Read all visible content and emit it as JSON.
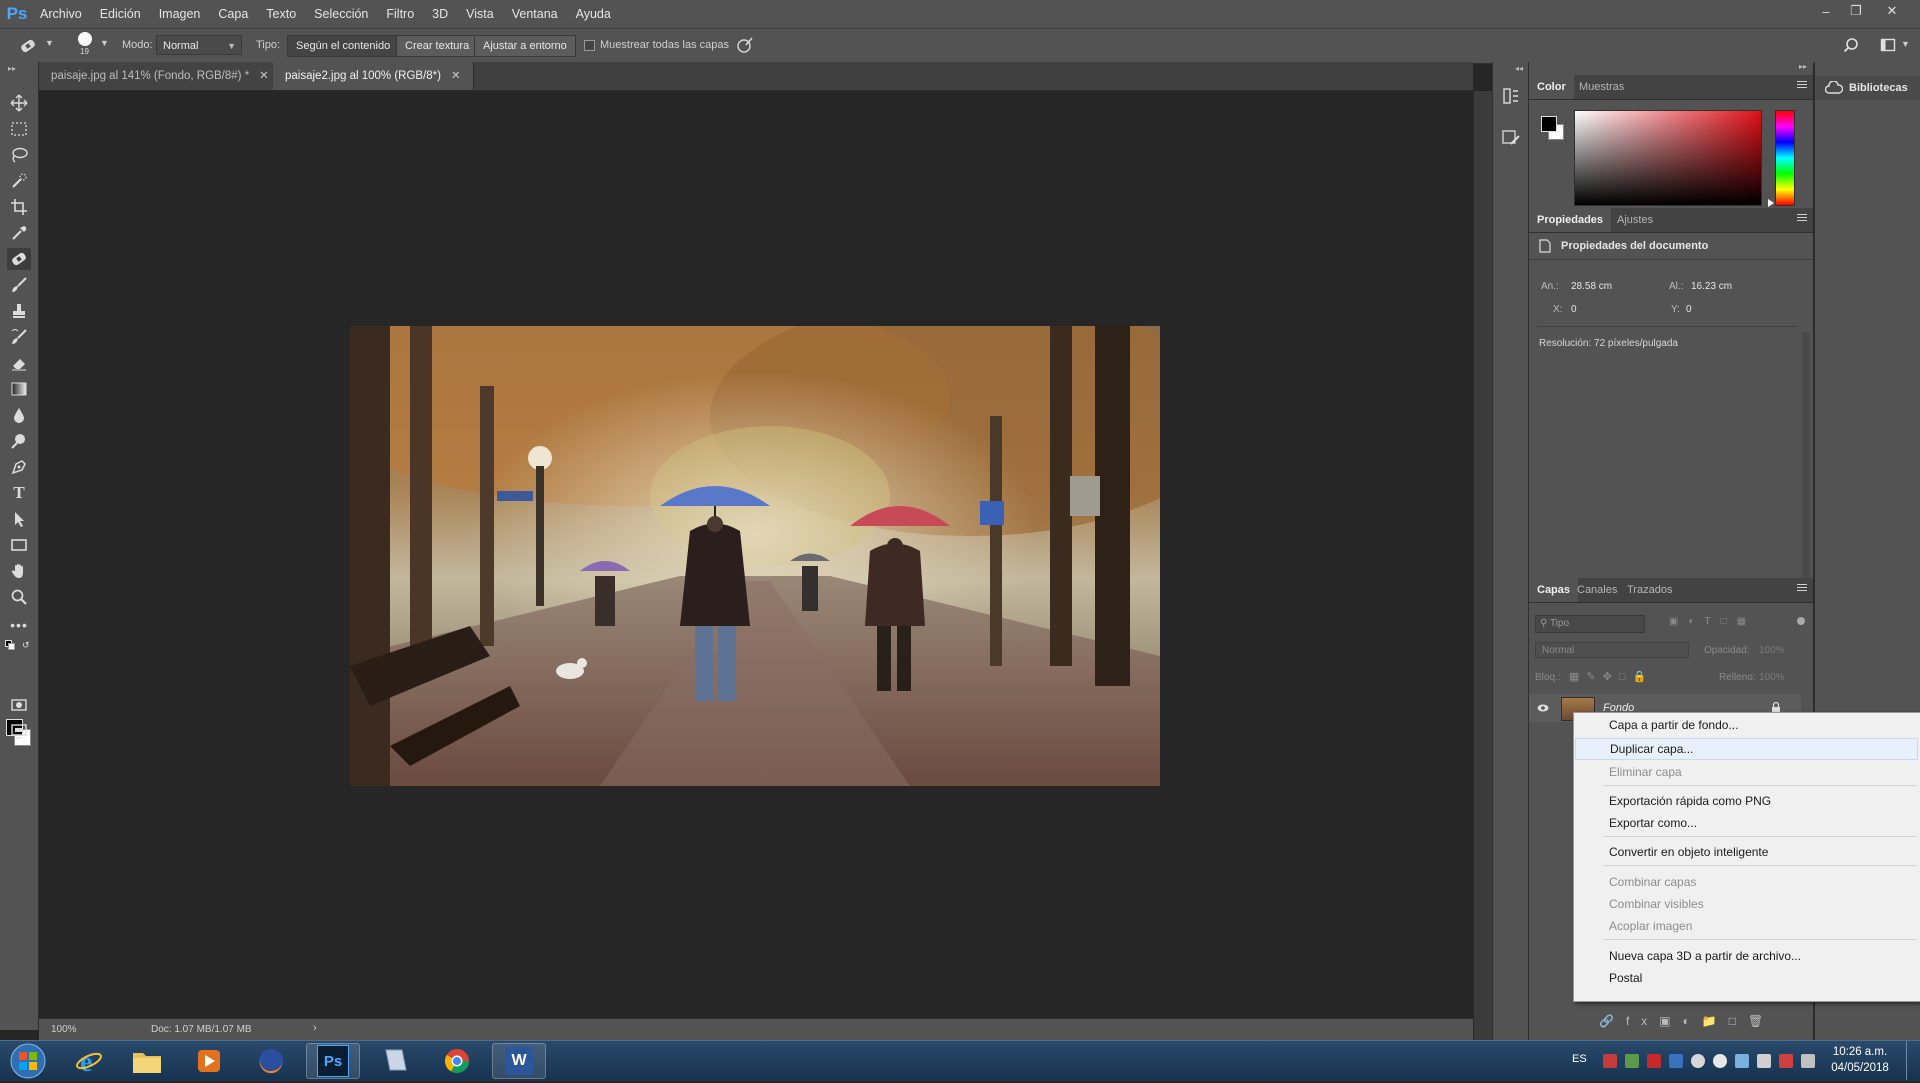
{
  "app": {
    "logo": "Ps"
  },
  "menu": [
    "Archivo",
    "Edición",
    "Imagen",
    "Capa",
    "Texto",
    "Selección",
    "Filtro",
    "3D",
    "Vista",
    "Ventana",
    "Ayuda"
  ],
  "options": {
    "brush_size": "19",
    "mode_label": "Modo:",
    "mode_value": "Normal",
    "type_label": "Tipo:",
    "type_buttons": [
      "Según el contenido",
      "Crear textura",
      "Ajustar a entorno"
    ],
    "sample_all": "Muestrear todas las capas"
  },
  "tabs": [
    {
      "label": "paisaje.jpg al 141% (Fondo, RGB/8#) *"
    },
    {
      "label": "paisaje2.jpg al 100% (RGB/8*)"
    }
  ],
  "status": {
    "zoom": "100%",
    "doc": "Doc: 1.07 MB/1.07 MB"
  },
  "color_panel": {
    "tabs": [
      "Color",
      "Muestras"
    ]
  },
  "properties_panel": {
    "tabs": [
      "Propiedades",
      "Ajustes"
    ],
    "title": "Propiedades del documento",
    "width_label": "An.:",
    "width_value": "28.58 cm",
    "height_label": "Al.:",
    "height_value": "16.23 cm",
    "x_label": "X:",
    "x_value": "0",
    "y_label": "Y:",
    "y_value": "0",
    "resolution": "Resolución: 72 píxeles/pulgada"
  },
  "layers_panel": {
    "tabs": [
      "Capas",
      "Canales",
      "Trazados"
    ],
    "filter_placeholder": "Tipo",
    "blend_mode": "Normal",
    "opacity_label": "Opacidad:",
    "opacity_value": "100%",
    "lock_label": "Bloq.:",
    "fill_label": "Relleno:",
    "fill_value": "100%",
    "layer_name": "Fondo"
  },
  "libraries": {
    "label": "Bibliotecas"
  },
  "context_menu": {
    "items": [
      {
        "label": "Capa a partir de fondo...",
        "disabled": false
      },
      {
        "label": "Duplicar capa...",
        "disabled": false
      },
      {
        "label": "Eliminar capa",
        "disabled": true
      },
      {
        "label": "Exportación rápida como PNG",
        "disabled": false
      },
      {
        "label": "Exportar como...",
        "disabled": false
      },
      {
        "label": "Convertir en objeto inteligente",
        "disabled": false
      },
      {
        "label": "Combinar capas",
        "disabled": true
      },
      {
        "label": "Combinar visibles",
        "disabled": true
      },
      {
        "label": "Acoplar imagen",
        "disabled": true
      },
      {
        "label": "Nueva capa 3D a partir de archivo...",
        "disabled": false
      },
      {
        "label": "Postal",
        "disabled": false
      }
    ]
  },
  "taskbar": {
    "lang": "ES",
    "time": "10:26 a.m.",
    "date": "04/05/2018"
  },
  "colors": {
    "ui_dark": "#535353",
    "canvas": "#262626",
    "accent": "#4aa8ff"
  }
}
